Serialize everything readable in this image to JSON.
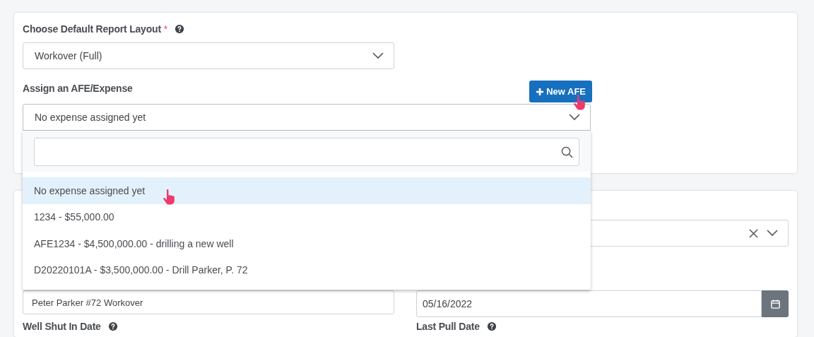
{
  "layout_field": {
    "label": "Choose Default Report Layout",
    "required_mark": "*",
    "value": "Workover (Full)"
  },
  "afe_field": {
    "label": "Assign an AFE/Expense",
    "button": "New AFE",
    "value": "No expense assigned yet",
    "expanded": true,
    "options": [
      {
        "label": "No expense assigned yet",
        "selected": true
      },
      {
        "label": "1234 - $55,000.00",
        "selected": false
      },
      {
        "label": "AFE1234 - $4,500,000.00 - drilling a new well",
        "selected": false
      },
      {
        "label": "D20220101A - $3,500,000.00 - Drill Parker, P. 72",
        "selected": false
      }
    ]
  },
  "details": {
    "name_value": "Peter Parker #72 Workover",
    "date_value": "05/16/2022",
    "labels": [
      "Well Shut In Date",
      "Last Pull Date"
    ]
  }
}
